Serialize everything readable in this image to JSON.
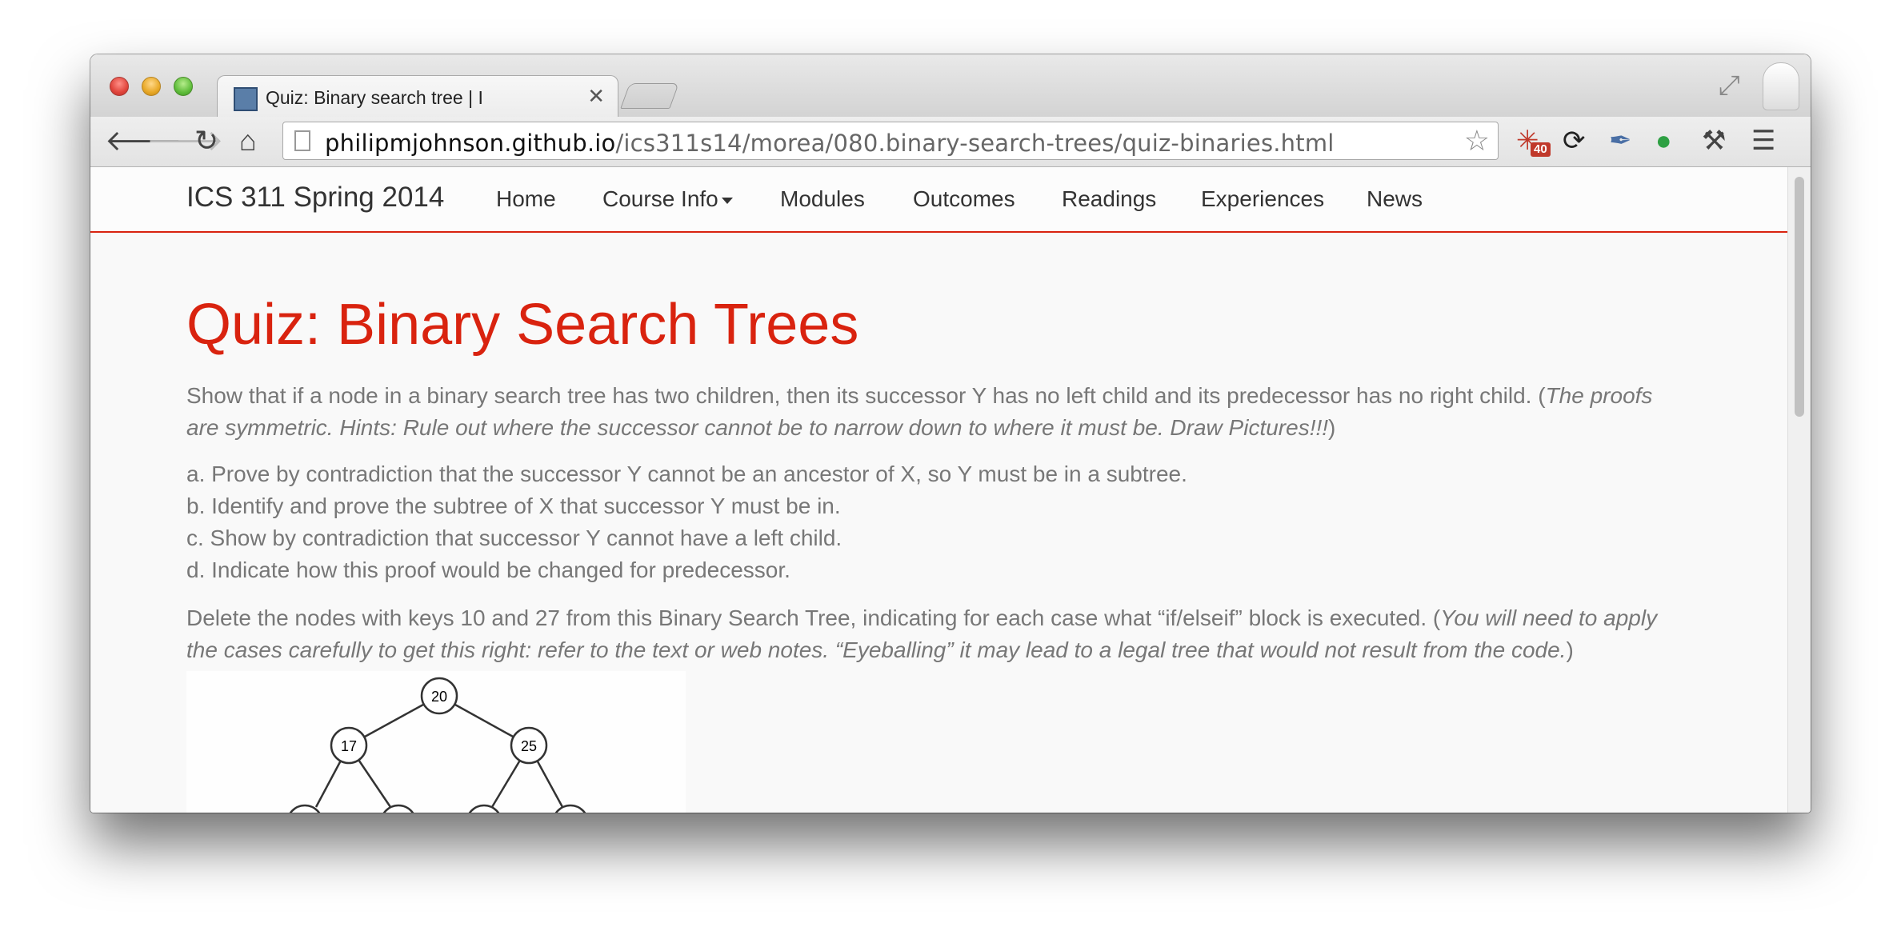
{
  "browser": {
    "tab_title": "Quiz: Binary search tree | I",
    "tab_close": "✕",
    "url_host": "philipmjohnson.github.io",
    "url_path": "/ics311s14/morea/080.binary-search-trees/quiz-binaries.html",
    "ext_badge": "40"
  },
  "navbar": {
    "brand": "ICS 311 Spring 2014",
    "items": [
      "Home",
      "Course Info",
      "Modules",
      "Outcomes",
      "Readings",
      "Experiences",
      "News"
    ]
  },
  "page": {
    "title": "Quiz: Binary Search Trees",
    "q1_text": "Show that if a node in a binary search tree has two children, then its successor Y has no left child and its predecessor has no right child. (",
    "q1_italic": "The proofs are symmetric. Hints: Rule out where the successor cannot be to narrow down to where it must be. Draw Pictures!!!",
    "q1_end": ")",
    "q1_parts": [
      "a. Prove by contradiction that the successor Y cannot be an ancestor of X, so Y must be in a subtree.",
      "b. Identify and prove the subtree of X that successor Y must be in.",
      "c. Show by contradiction that successor Y cannot have a left child.",
      "d. Indicate how this proof would be changed for predecessor."
    ],
    "q2_text": "Delete the nodes with keys 10 and 27 from this Binary Search Tree, indicating for each case what “if/elseif” block is executed. (",
    "q2_italic": "You will need to apply the cases carefully to get this right: refer to the text or web notes. “Eyeballing” it may lead to a legal tree that would not result from the code.",
    "q2_end": ")"
  },
  "tree": {
    "nodes": [
      "20",
      "17",
      "25"
    ]
  }
}
